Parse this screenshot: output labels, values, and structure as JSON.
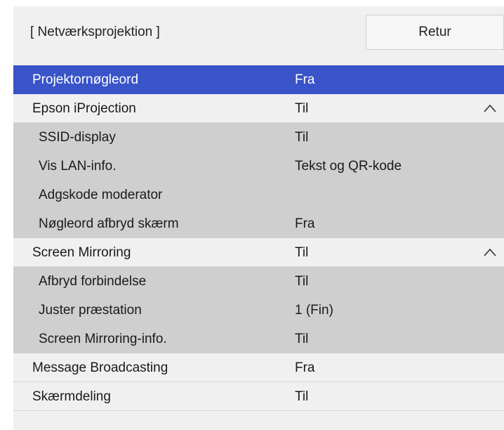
{
  "header": {
    "title": "[ Netværksprojektion ]",
    "back_label": "Retur"
  },
  "colors": {
    "selected_row": "#3954c8",
    "menu_background": "#f0f0f0",
    "sub_row_background": "#cfcfcf"
  },
  "rows": [
    {
      "label": "Projektornøgleord",
      "value": "Fra",
      "selected": true
    },
    {
      "label": "Epson iProjection",
      "value": "Til",
      "icon": "chevron-up-icon"
    },
    {
      "label": "SSID-display",
      "value": "Til"
    },
    {
      "label": "Vis LAN-info.",
      "value": "Tekst og QR-kode"
    },
    {
      "label": "Adgskode moderator",
      "value": ""
    },
    {
      "label": "Nøgleord afbryd skærm",
      "value": "Fra"
    },
    {
      "label": "Screen Mirroring",
      "value": "Til",
      "icon": "chevron-up-icon"
    },
    {
      "label": "Afbryd forbindelse",
      "value": "Til"
    },
    {
      "label": "Juster præstation",
      "value": "1 (Fin)"
    },
    {
      "label": "Screen Mirroring-info.",
      "value": "Til"
    },
    {
      "label": "Message Broadcasting",
      "value": "Fra"
    },
    {
      "label": "Skærmdeling",
      "value": "Til"
    }
  ]
}
